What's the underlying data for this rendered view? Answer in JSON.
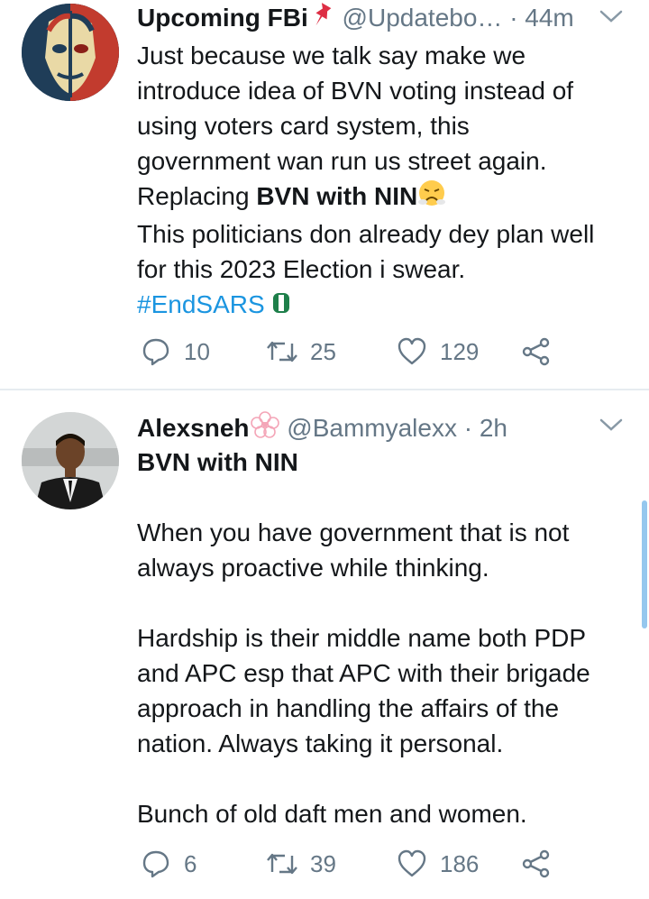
{
  "colors": {
    "text": "#14171a",
    "secondary": "#657786",
    "link": "#1b95e0",
    "divider": "#e6ecf0"
  },
  "tweets": [
    {
      "name": "Upcoming FBi",
      "name_emoji": "pushpin-icon",
      "handle": "@Updatebo…",
      "time": "· 44m",
      "lines": [
        "Just because we talk say make we",
        "introduce idea of BVN voting instead of",
        "using voters card system, this",
        "government wan run us street again."
      ],
      "replacing_prefix": "Replacing ",
      "replacing_bold": "BVN with NIN",
      "lines2": [
        "This politicians don already dey plan well",
        "for this 2023 Election i swear."
      ],
      "hashtag": "#EndSARS",
      "replies": "10",
      "retweets": "25",
      "likes": "129"
    },
    {
      "name": "Alexsneh",
      "handle": "@Bammyalexx",
      "time": "· 2h",
      "bold_line": "BVN with NIN",
      "para1": [
        "When you have government that is not",
        "always proactive while thinking."
      ],
      "para2": [
        "Hardship is their middle name both PDP",
        "and APC esp that APC with their brigade",
        "approach in handling the affairs of the",
        "nation. Always taking it personal."
      ],
      "para3": [
        "Bunch of old daft men and women."
      ],
      "replies": "6",
      "retweets": "39",
      "likes": "186"
    }
  ]
}
